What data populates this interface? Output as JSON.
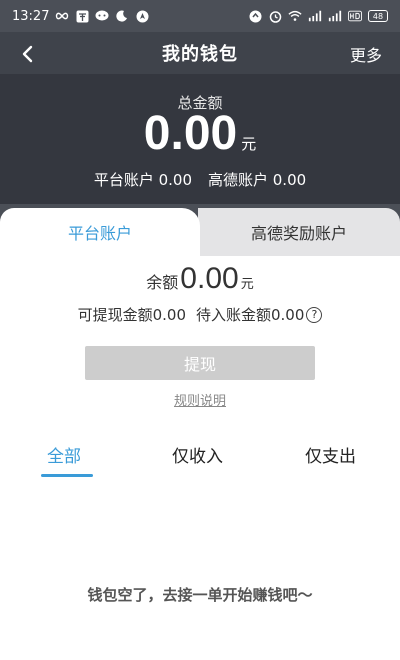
{
  "status_bar": {
    "time": "13:27",
    "battery": "48"
  },
  "navbar": {
    "title": "我的钱包",
    "more_label": "更多"
  },
  "summary": {
    "total_label": "总金额",
    "total_value": "0.00",
    "total_unit": "元",
    "platform_account": "平台账户 0.00",
    "amap_account": "高德账户 0.00"
  },
  "account_tabs": [
    {
      "label": "平台账户",
      "active": true
    },
    {
      "label": "高德奖励账户",
      "active": false
    }
  ],
  "balance": {
    "label": "余额",
    "value": "0.00",
    "unit": "元",
    "withdrawable": "可提现金额0.00",
    "pending": "待入账金额0.00"
  },
  "actions": {
    "withdraw_label": "提现",
    "rules_label": "规则说明"
  },
  "filter_tabs": [
    {
      "label": "全部",
      "active": true
    },
    {
      "label": "仅收入",
      "active": false
    },
    {
      "label": "仅支出",
      "active": false
    }
  ],
  "empty_message": "钱包空了，去接一单开始赚钱吧～",
  "colors": {
    "accent": "#3a9bd8",
    "header_dark": "#34373f",
    "button_disabled": "#cdcdcd"
  }
}
